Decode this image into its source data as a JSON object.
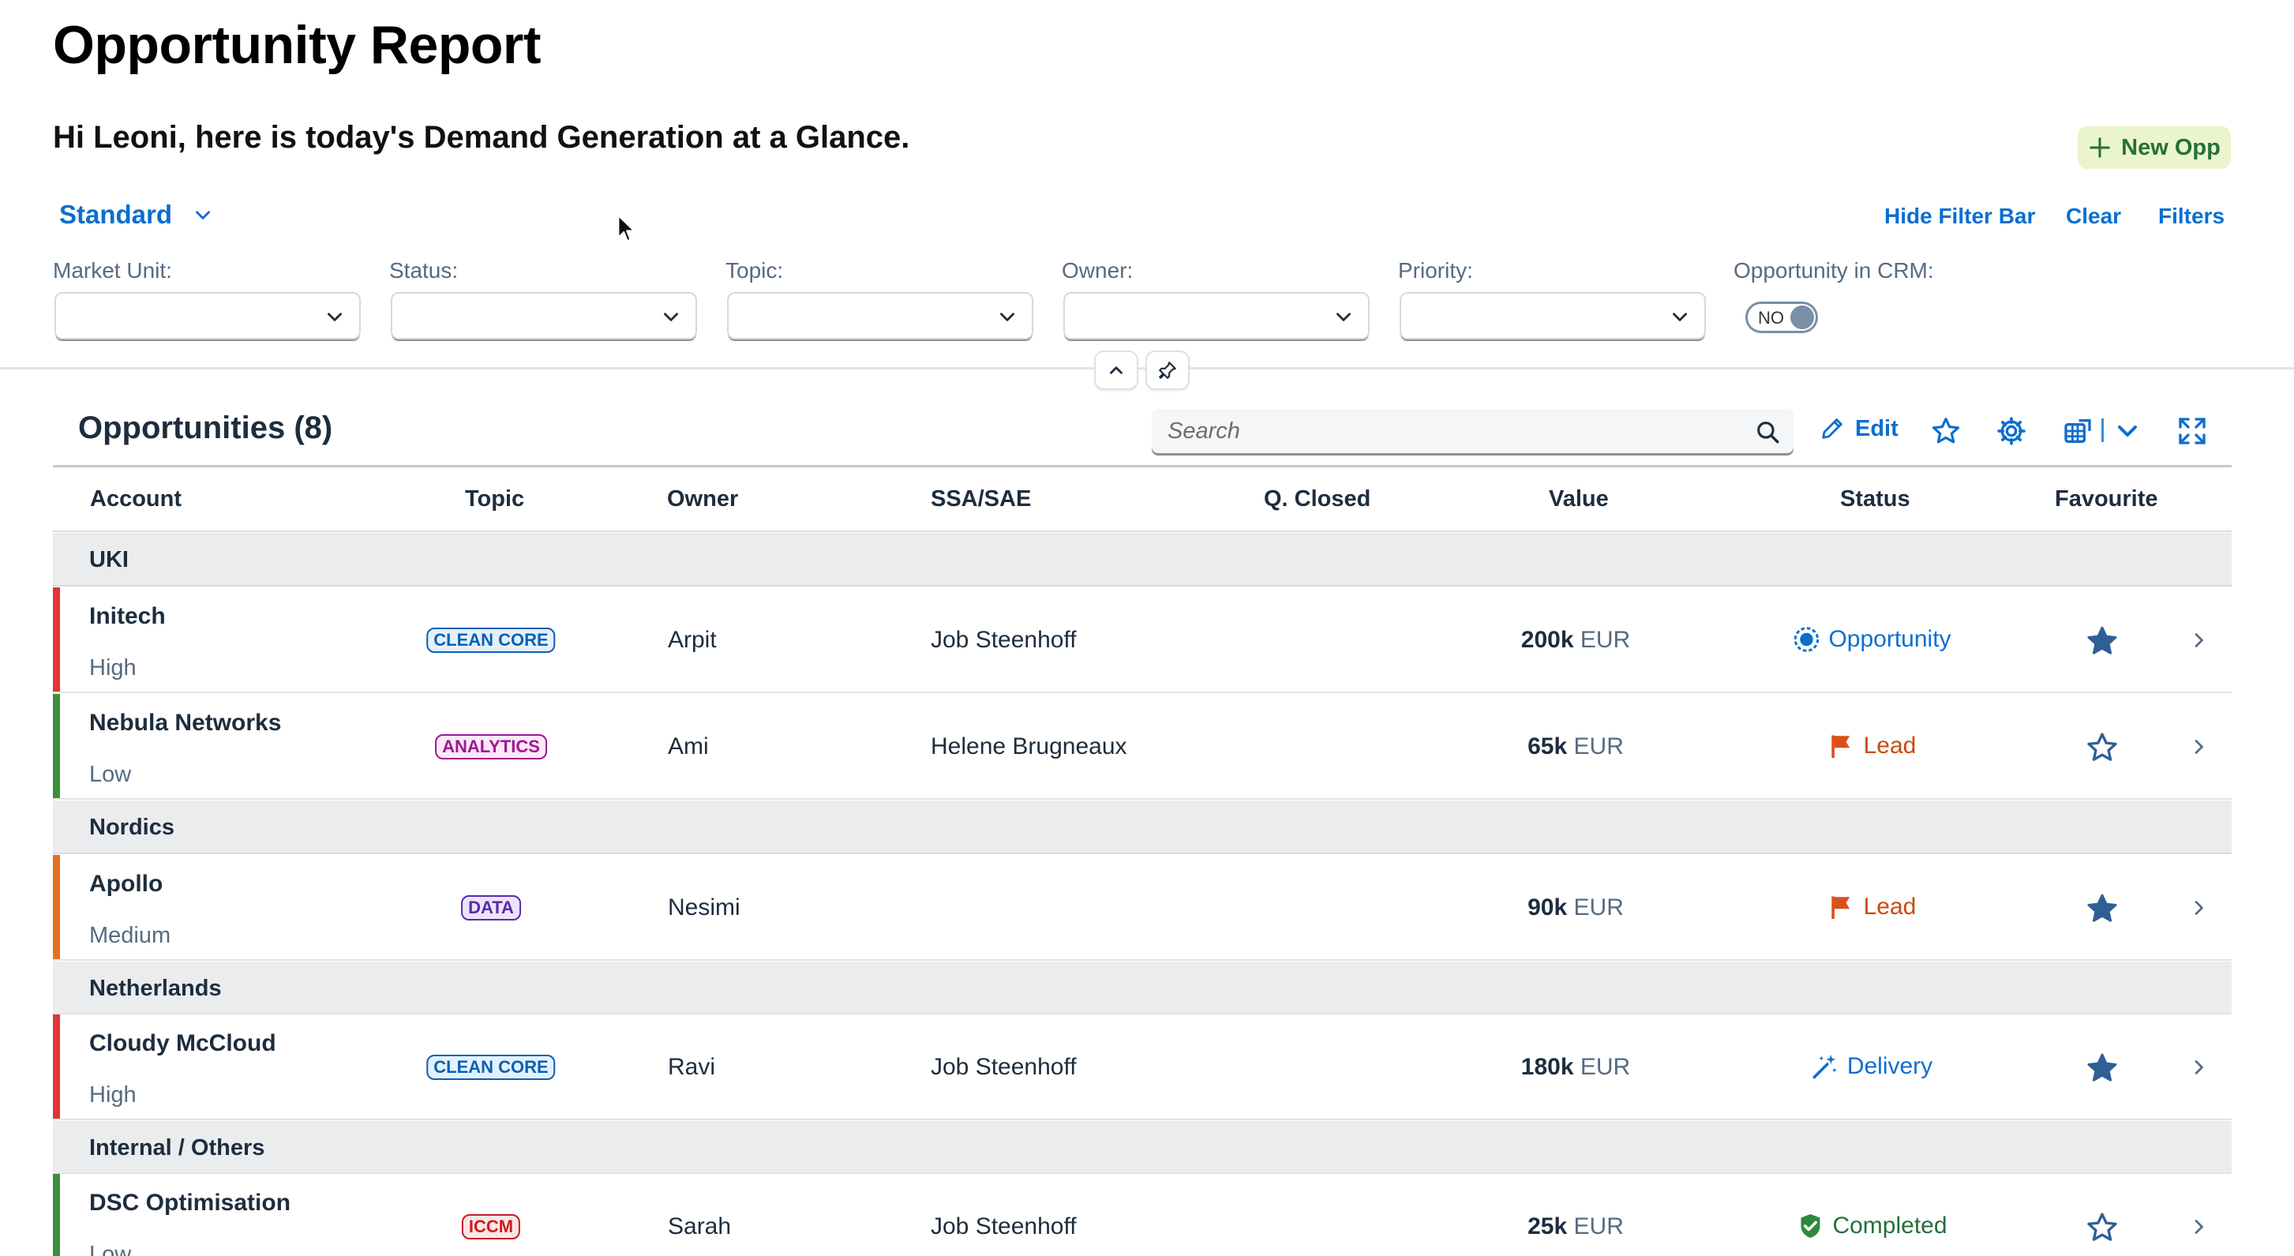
{
  "page": {
    "title": "Opportunity Report",
    "greeting": "Hi Leoni, here is today's Demand Generation at a Glance.",
    "new_button": "New Opp"
  },
  "filterbar": {
    "variant": "Standard",
    "hide_filter_bar": "Hide Filter Bar",
    "clear": "Clear",
    "filters": "Filters",
    "fields": [
      {
        "label": "Market Unit:",
        "value": ""
      },
      {
        "label": "Status:",
        "value": ""
      },
      {
        "label": "Topic:",
        "value": ""
      },
      {
        "label": "Owner:",
        "value": ""
      },
      {
        "label": "Priority:",
        "value": ""
      }
    ],
    "crm_label": "Opportunity in CRM:",
    "crm_toggle": "NO"
  },
  "table": {
    "title": "Opportunities (8)",
    "search_placeholder": "Search",
    "edit_label": "Edit",
    "columns": [
      "Account",
      "Topic",
      "Owner",
      "SSA/SAE",
      "Q. Closed",
      "Value",
      "Status",
      "Favourite"
    ],
    "groups": [
      {
        "label": "UKI"
      },
      {
        "label": "Nordics"
      },
      {
        "label": "Netherlands"
      },
      {
        "label": "Internal / Others"
      }
    ],
    "rows": [
      {
        "account": "Initech",
        "priority": "High",
        "topic": "CLEAN CORE",
        "owner": "Arpit",
        "ssa": "Job Steenhoff",
        "q_closed": "",
        "value_amount": "200k",
        "value_currency": "EUR",
        "status": "Opportunity",
        "favourite": true
      },
      {
        "account": "Nebula Networks",
        "priority": "Low",
        "topic": "ANALYTICS",
        "owner": "Ami",
        "ssa": "Helene Brugneaux",
        "q_closed": "",
        "value_amount": "65k",
        "value_currency": "EUR",
        "status": "Lead",
        "favourite": false
      },
      {
        "account": "Apollo",
        "priority": "Medium",
        "topic": "DATA",
        "owner": "Nesimi",
        "ssa": "",
        "q_closed": "",
        "value_amount": "90k",
        "value_currency": "EUR",
        "status": "Lead",
        "favourite": true
      },
      {
        "account": "Cloudy McCloud",
        "priority": "High",
        "topic": "CLEAN CORE",
        "owner": "Ravi",
        "ssa": "Job Steenhoff",
        "q_closed": "",
        "value_amount": "180k",
        "value_currency": "EUR",
        "status": "Delivery",
        "favourite": true
      },
      {
        "account": "DSC Optimisation",
        "priority": "Low",
        "topic": "ICCM",
        "owner": "Sarah",
        "ssa": "Job Steenhoff",
        "q_closed": "",
        "value_amount": "25k",
        "value_currency": "EUR",
        "status": "Completed",
        "favourite": false
      }
    ]
  },
  "colors": {
    "accent": "#0a6ed1",
    "priority_high": "#e13433",
    "priority_medium": "#e76f1f",
    "priority_low": "#3c8f3c",
    "status_opportunity": "#0a6ed1",
    "status_lead": "#c84b0b",
    "status_delivery": "#0a6ed1",
    "status_completed": "#256f3a",
    "favourite_star": "#2f5f95"
  },
  "icons": [
    "plus-icon",
    "chevron-down-icon",
    "chevron-up-icon",
    "pin-icon",
    "search-icon",
    "pencil-icon",
    "star-icon",
    "gear-icon",
    "export-table-icon",
    "fullscreen-icon",
    "flag-icon",
    "target-icon",
    "wand-icon",
    "check-badge-icon",
    "chevron-right-icon",
    "mouse-cursor-icon"
  ]
}
